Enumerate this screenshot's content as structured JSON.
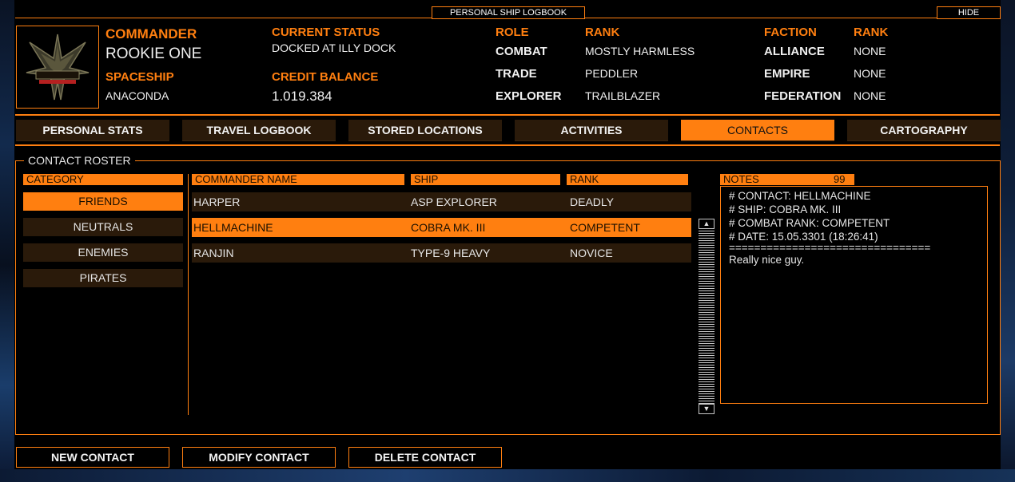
{
  "window": {
    "title": "PERSONAL SHIP LOGBOOK",
    "hide_label": "HIDE"
  },
  "commander": {
    "label": "COMMANDER",
    "name": "ROOKIE ONE",
    "spaceship_label": "SPACESHIP",
    "spaceship": "ANACONDA"
  },
  "status": {
    "label": "CURRENT STATUS",
    "value": "DOCKED AT ILLY DOCK",
    "credit_label": "CREDIT BALANCE",
    "credit_value": "1.019.384"
  },
  "roles": {
    "role_label": "ROLE",
    "rank_label": "RANK",
    "items": [
      {
        "role": "COMBAT",
        "rank": "MOSTLY HARMLESS"
      },
      {
        "role": "TRADE",
        "rank": "PEDDLER"
      },
      {
        "role": "EXPLORER",
        "rank": "TRAILBLAZER"
      }
    ]
  },
  "factions": {
    "faction_label": "FACTION",
    "rank_label": "RANK",
    "items": [
      {
        "faction": "ALLIANCE",
        "rank": "NONE"
      },
      {
        "faction": "EMPIRE",
        "rank": "NONE"
      },
      {
        "faction": "FEDERATION",
        "rank": "NONE"
      }
    ]
  },
  "tabs": [
    {
      "label": "PERSONAL STATS"
    },
    {
      "label": "TRAVEL LOGBOOK"
    },
    {
      "label": "STORED LOCATIONS"
    },
    {
      "label": "ACTIVITIES"
    },
    {
      "label": "CONTACTS",
      "active": true
    },
    {
      "label": "CARTOGRAPHY"
    }
  ],
  "roster": {
    "legend": "CONTACT ROSTER",
    "category_header": "CATEGORY",
    "categories": [
      {
        "label": "FRIENDS",
        "active": true
      },
      {
        "label": "NEUTRALS"
      },
      {
        "label": "ENEMIES"
      },
      {
        "label": "PIRATES"
      }
    ],
    "columns": {
      "name": "COMMANDER NAME",
      "ship": "SHIP",
      "rank": "RANK"
    },
    "contacts": [
      {
        "name": "HARPER",
        "ship": "ASP EXPLORER",
        "rank": "DEADLY"
      },
      {
        "name": "HELLMACHINE",
        "ship": "COBRA MK. III",
        "rank": "COMPETENT",
        "active": true
      },
      {
        "name": "RANJIN",
        "ship": "TYPE-9 HEAVY",
        "rank": "NOVICE"
      }
    ],
    "scroll": {
      "up_icon": "▲",
      "down_icon": "▼"
    }
  },
  "notes": {
    "label": "NOTES",
    "count": "99",
    "lines": [
      "# CONTACT: HELLMACHINE",
      "# SHIP: COBRA MK. III",
      "# COMBAT RANK: COMPETENT",
      "# DATE: 15.05.3301 (18:26:41)",
      "================================",
      "Really nice guy."
    ]
  },
  "actions": {
    "new_contact": "NEW CONTACT",
    "modify_contact": "MODIFY CONTACT",
    "delete_contact": "DELETE CONTACT"
  },
  "colors": {
    "accent": "#ff7f10",
    "panel": "#2a1a0a",
    "background": "#000000"
  }
}
